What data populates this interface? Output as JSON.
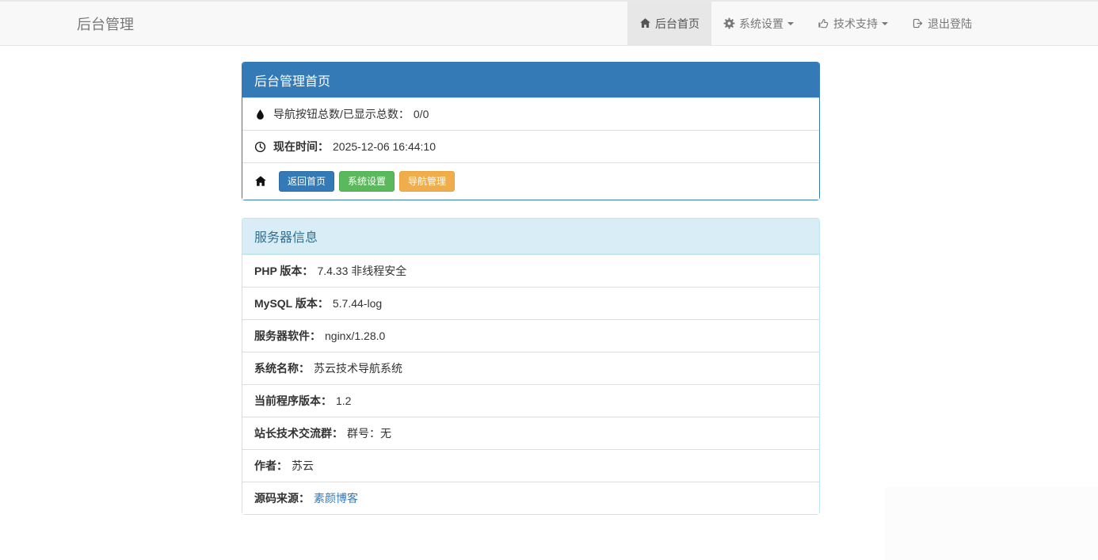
{
  "colors": {
    "primary": "#337ab7",
    "success": "#5cb85c",
    "warning": "#f0ad4e",
    "info_header_bg": "#d9edf7",
    "info_header_text": "#31708f",
    "info_border": "#bce8f1",
    "navbar_bg": "#f8f8f8",
    "navbar_active_bg": "#e7e7e7",
    "link": "#337ab7"
  },
  "navbar": {
    "brand": "后台管理",
    "items": [
      {
        "label": "后台首页",
        "icon": "home",
        "active": true
      },
      {
        "label": "系统设置",
        "icon": "gear",
        "dropdown": true
      },
      {
        "label": "技术支持",
        "icon": "thumbs-up",
        "dropdown": true
      },
      {
        "label": "退出登陆",
        "icon": "sign-out"
      }
    ]
  },
  "admin_panel": {
    "title": "后台管理首页",
    "nav_count_label": "导航按钮总数/已显示总数：",
    "nav_count_value": "0/0",
    "time_label": "现在时间：",
    "time_value": "2025-12-06 16:44:10",
    "buttons": [
      {
        "label": "返回首页",
        "style": "primary"
      },
      {
        "label": "系统设置",
        "style": "success"
      },
      {
        "label": "导航管理",
        "style": "warning"
      }
    ]
  },
  "server_panel": {
    "title": "服务器信息",
    "rows": [
      {
        "label": "PHP 版本：",
        "value": "7.4.33 非线程安全"
      },
      {
        "label": "MySQL 版本：",
        "value": "5.7.44-log"
      },
      {
        "label": "服务器软件：",
        "value": "nginx/1.28.0"
      },
      {
        "label": "系统名称：",
        "value": "苏云技术导航系统"
      },
      {
        "label": "当前程序版本：",
        "value": "1.2"
      },
      {
        "label": "站长技术交流群：",
        "value": "群号：无"
      },
      {
        "label": "作者：",
        "value": "苏云"
      },
      {
        "label": "源码来源：",
        "value": "素颜博客",
        "is_link": true
      }
    ]
  }
}
